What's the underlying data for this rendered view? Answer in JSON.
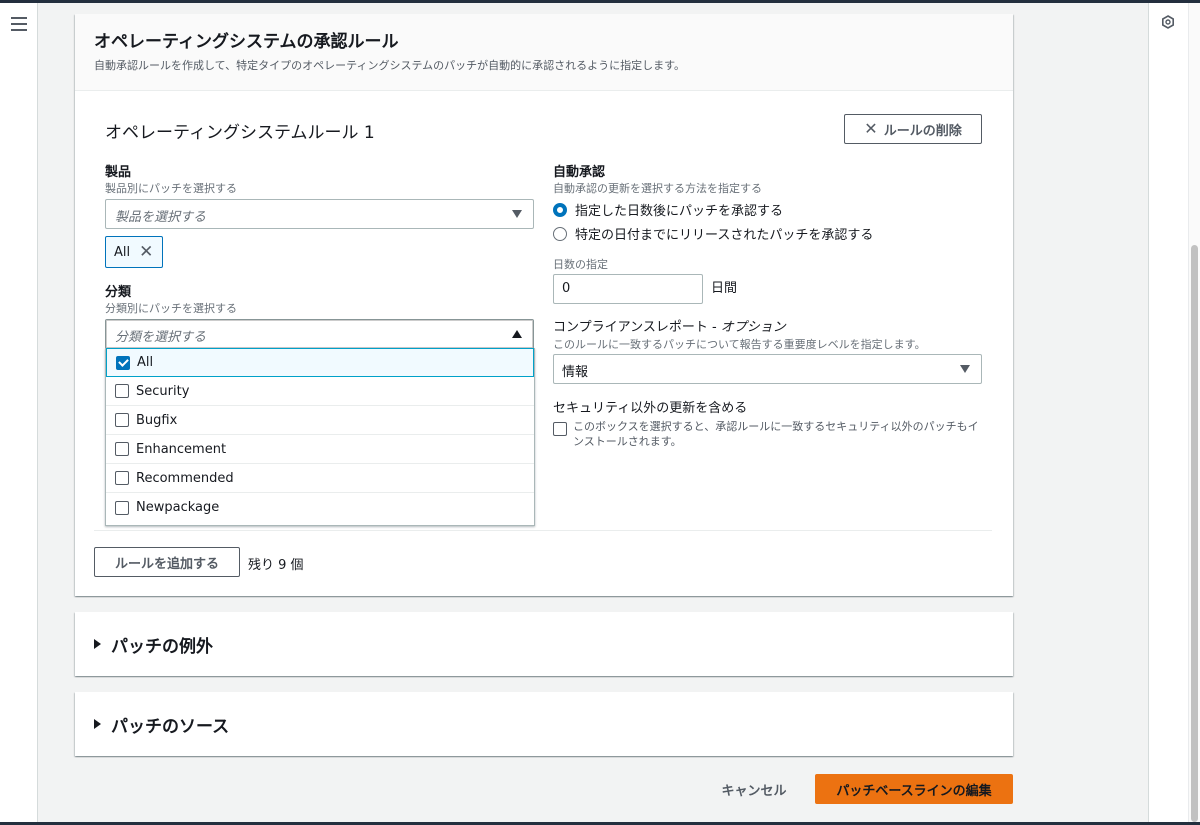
{
  "os_rules": {
    "title": "オペレーティングシステムの承認ルール",
    "description": "自動承認ルールを作成して、特定タイプのオペレーティングシステムのパッチが自動的に承認されるように指定します。",
    "rule_title": "オペレーティングシステムルール 1",
    "delete_button": "ルールの削除",
    "product": {
      "label": "製品",
      "description": "製品別にパッチを選択する",
      "placeholder": "製品を選択する",
      "token": "All"
    },
    "classification": {
      "label": "分類",
      "description": "分類別にパッチを選択する",
      "placeholder": "分類を選択する",
      "options": [
        {
          "label": "All",
          "checked": true
        },
        {
          "label": "Security",
          "checked": false
        },
        {
          "label": "Bugfix",
          "checked": false
        },
        {
          "label": "Enhancement",
          "checked": false
        },
        {
          "label": "Recommended",
          "checked": false
        },
        {
          "label": "Newpackage",
          "checked": false
        }
      ]
    },
    "auto_approval": {
      "label": "自動承認",
      "description": "自動承認の更新を選択する方法を指定する",
      "option_days": "指定した日数後にパッチを承認する",
      "option_date": "特定の日付までにリリースされたパッチを承認する",
      "selected": "days",
      "days_label": "日数の指定",
      "days_value": "0",
      "days_unit": "日間"
    },
    "compliance": {
      "label": "コンプライアンスレポート - ",
      "label_optional": "オプション",
      "description": "このルールに一致するパッチについて報告する重要度レベルを指定します。",
      "value": "情報"
    },
    "non_security": {
      "label": "セキュリティ以外の更新を含める",
      "description": "このボックスを選択すると、承認ルールに一致するセキュリティ以外のパッチもインストールされます。"
    },
    "add_rule_button": "ルールを追加する",
    "remaining": "残り 9 個"
  },
  "sections": {
    "exceptions": "パッチの例外",
    "sources": "パッチのソース"
  },
  "footer": {
    "cancel": "キャンセル",
    "submit": "パッチベースラインの編集"
  },
  "colors": {
    "primary": "#ec7211",
    "accent": "#0073bb"
  }
}
